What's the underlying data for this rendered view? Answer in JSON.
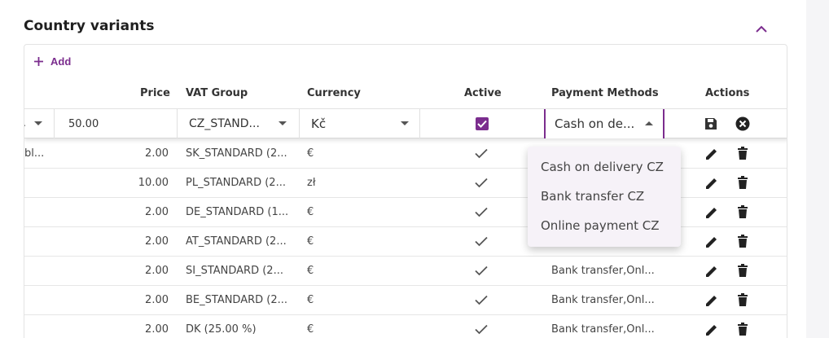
{
  "section": {
    "title": "Country variants"
  },
  "toolbar": {
    "add_label": "Add"
  },
  "headers": {
    "price": "Price",
    "vat_group": "VAT Group",
    "currency": "Currency",
    "active": "Active",
    "payment_methods": "Payment Methods",
    "actions": "Actions"
  },
  "edit_row": {
    "price": "50.00",
    "vat_group": "CZ_STAND...",
    "currency": "Kč",
    "active": true,
    "payment_methods": "Cash on de..."
  },
  "dropdown": {
    "options": [
      "Cash on delivery CZ",
      "Bank transfer CZ",
      "Online payment CZ"
    ]
  },
  "rows": [
    {
      "name": "bl...",
      "price": "2.00",
      "vat_group": "SK_STANDARD (2...",
      "currency": "€",
      "payment_methods": ""
    },
    {
      "name": "",
      "price": "10.00",
      "vat_group": "PL_STANDARD (2...",
      "currency": "zł",
      "payment_methods": ""
    },
    {
      "name": "",
      "price": "2.00",
      "vat_group": "DE_STANDARD (1...",
      "currency": "€",
      "payment_methods": ""
    },
    {
      "name": "",
      "price": "2.00",
      "vat_group": "AT_STANDARD (2...",
      "currency": "€",
      "payment_methods": ""
    },
    {
      "name": "",
      "price": "2.00",
      "vat_group": "SI_STANDARD (2...",
      "currency": "€",
      "payment_methods": "Bank transfer,Onl..."
    },
    {
      "name": "",
      "price": "2.00",
      "vat_group": "BE_STANDARD (2...",
      "currency": "€",
      "payment_methods": "Bank transfer,Onl..."
    },
    {
      "name": "",
      "price": "2.00",
      "vat_group": "DK (25.00 %)",
      "currency": "€",
      "payment_methods": "Bank transfer,Onl..."
    }
  ],
  "colors": {
    "accent": "#7b2d8e",
    "text": "#333333",
    "border": "#e3e3e3"
  }
}
